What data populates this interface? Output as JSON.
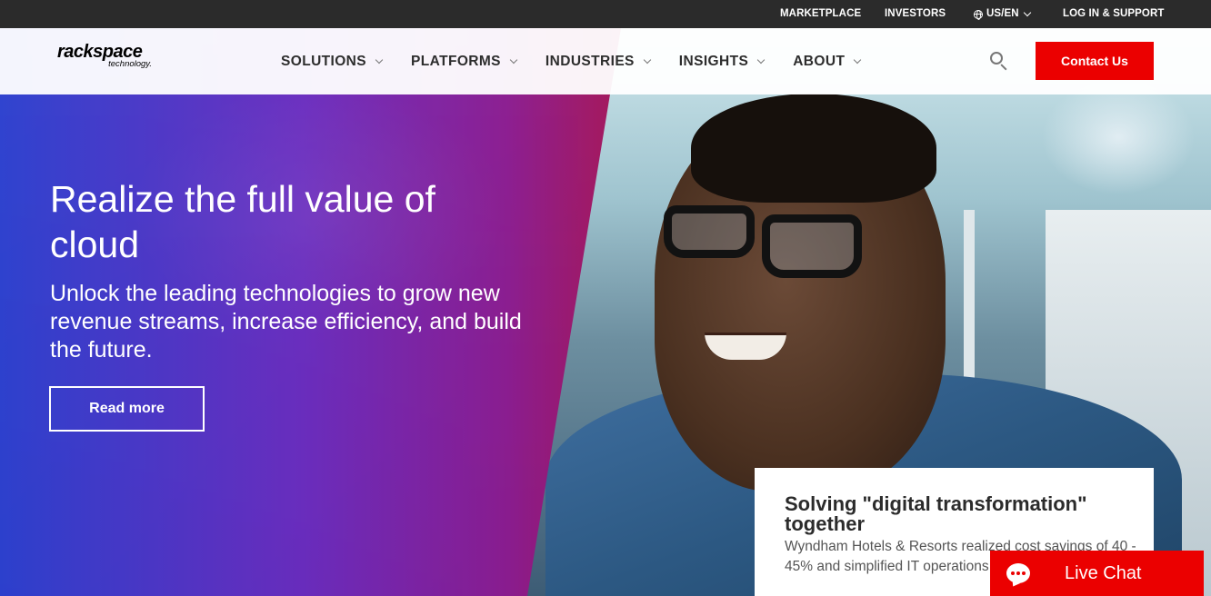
{
  "utility_bar": {
    "marketplace": "MARKETPLACE",
    "investors": "INVESTORS",
    "locale": "US/EN",
    "login": "LOG IN & SUPPORT"
  },
  "header": {
    "logo_primary": "rackspace",
    "logo_secondary": "technology.",
    "nav": [
      "SOLUTIONS",
      "PLATFORMS",
      "INDUSTRIES",
      "INSIGHTS",
      "ABOUT"
    ],
    "contact_label": "Contact Us"
  },
  "hero": {
    "title": "Realize the full value of cloud",
    "subtitle": "Unlock the leading technologies to grow new revenue streams, increase efficiency, and build the future.",
    "cta_label": "Read more"
  },
  "story_card": {
    "title": "Solving \"digital transformation\" together",
    "text": "Wyndham Hotels & Resorts realized cost savings of 40 - 45% and simplified IT operations"
  },
  "live_chat": {
    "label": "Live Chat"
  },
  "colors": {
    "brand_red": "#eb0000",
    "utility_bg": "#2b2b2b"
  }
}
